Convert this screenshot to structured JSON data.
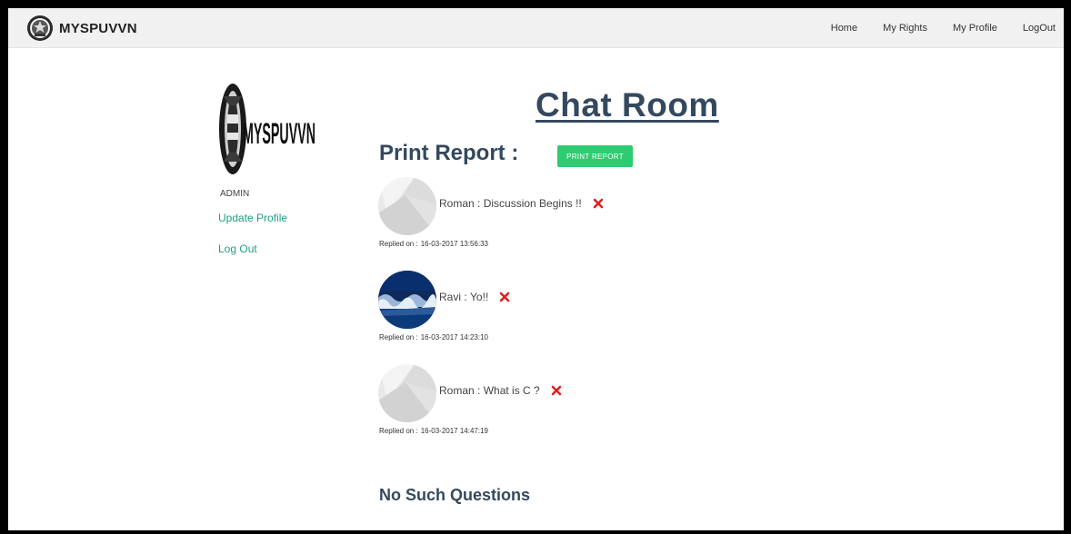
{
  "brand": {
    "name": "MYSPUVVN"
  },
  "nav": [
    {
      "label": "Home"
    },
    {
      "label": "My Rights"
    },
    {
      "label": "My Profile"
    },
    {
      "label": "LogOut"
    }
  ],
  "sidebar": {
    "logo_text": "MYSPUVVN",
    "role": "ADMIN",
    "links": [
      {
        "label": "Update Profile"
      },
      {
        "label": "Log Out"
      }
    ]
  },
  "main": {
    "title": "Chat Room",
    "report_label": "Print Report :",
    "print_button": "PRINT REPORT",
    "replied_prefix": "Replied on :",
    "messages": [
      {
        "author": "Roman",
        "separator": " : ",
        "text": "Discussion Begins !!",
        "timestamp": "16-03-2017 13:56:33",
        "avatar": "default-avatar"
      },
      {
        "author": "Ravi",
        "separator": " : ",
        "text": "Yo!!",
        "timestamp": "16-03-2017 14:23:10",
        "avatar": "wave-avatar"
      },
      {
        "author": "Roman",
        "separator": " : ",
        "text": "What is C ?",
        "timestamp": "16-03-2017 14:47:19",
        "avatar": "default-avatar"
      }
    ],
    "footer_text": "No Such Questions"
  },
  "colors": {
    "heading": "#34495e",
    "accent_green": "#2ecc71",
    "link_teal": "#1e9e88",
    "delete_red": "#e02020",
    "navbar_bg": "#f1f1f1"
  }
}
